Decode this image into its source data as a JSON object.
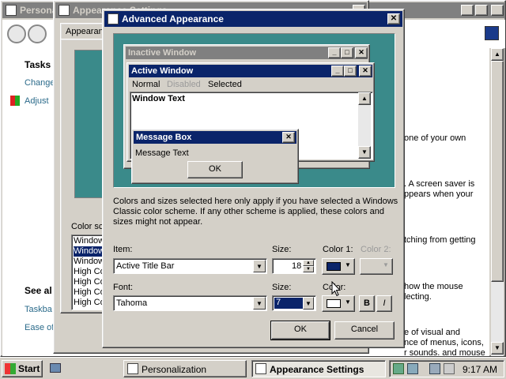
{
  "personalization": {
    "title": "Persona",
    "tasks_heading": "Tasks",
    "links": [
      "Change",
      "Adjust"
    ],
    "see_also": "See al",
    "see_also_links": [
      "Taskba",
      "Ease of"
    ],
    "right_text": [
      "one of your own",
      ". A screen saver is",
      "ppears when your",
      "tching from getting",
      "how the mouse",
      "lecting.",
      "e of visual and",
      "nce of menus, icons,",
      "r sounds, and mouse"
    ]
  },
  "appearance_settings": {
    "title": "Appearance Settings",
    "tab_label": "Appearan",
    "color_scheme_label": "Color sc",
    "scheme_items": [
      "Window",
      "Window",
      "Window",
      "High Co",
      "High Co",
      "High Co",
      "High Co"
    ]
  },
  "dialog": {
    "title": "Advanced Appearance",
    "preview": {
      "inactive_title": "Inactive Window",
      "active_title": "Active Window",
      "menu_normal": "Normal",
      "menu_disabled": "Disabled",
      "menu_selected": "Selected",
      "window_text": "Window Text",
      "msgbox_title": "Message Box",
      "msgbox_text": "Message Text",
      "msgbox_ok": "OK"
    },
    "info_text_1": "Colors and sizes selected here only apply if you have selected a Windows",
    "info_text_2": "Classic color scheme. If any other scheme is applied, these colors and",
    "info_text_3": "sizes might not appear.",
    "item_label": "Item:",
    "item_value": "Active Title Bar",
    "size_label": "Size:",
    "size_value": "18",
    "color1_label": "Color 1:",
    "color2_label": "Color 2:",
    "font_label": "Font:",
    "font_value": "Tahoma",
    "font_size_label": "Size:",
    "font_size_value": "7",
    "font_color_label": "Color:",
    "bold_label": "B",
    "italic_label": "I",
    "ok_label": "OK",
    "cancel_label": "Cancel",
    "colors": {
      "color1": "#0a246a",
      "font_color": "#ffffff",
      "desktop": "#3a8a8a"
    }
  },
  "taskbar": {
    "start": "Start",
    "tasks": [
      "Personalization",
      "Appearance Settings"
    ],
    "clock": "9:17 AM"
  }
}
